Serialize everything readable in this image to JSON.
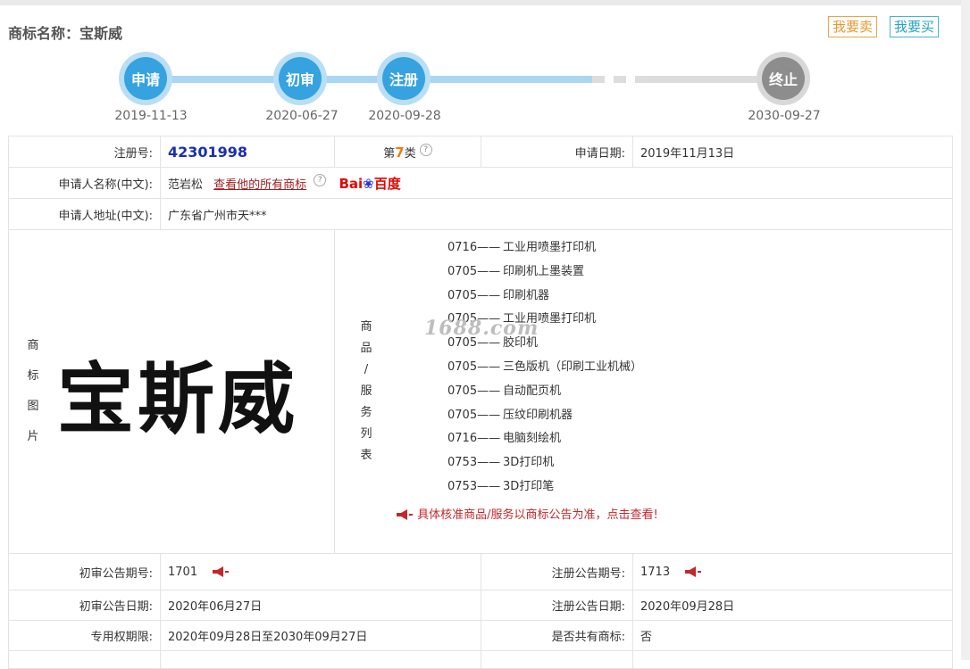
{
  "header": {
    "title": "商标名称：宝斯威",
    "sell_label": "我要卖",
    "buy_label": "我要买"
  },
  "timeline": {
    "nodes": [
      {
        "label": "申请",
        "date": "2019-11-13"
      },
      {
        "label": "初审",
        "date": "2020-06-27"
      },
      {
        "label": "注册",
        "date": "2020-09-28"
      },
      {
        "label": "终止",
        "date": "2030-09-27"
      }
    ]
  },
  "info": {
    "reg_no_label": "注册号:",
    "reg_no": "42301998",
    "class_prefix": "第",
    "class_num": "7",
    "class_suffix": "类",
    "apply_date_label": "申请日期:",
    "apply_date": "2019年11月13日",
    "applicant_label": "申请人名称(中文):",
    "applicant": "范岩松",
    "view_all_link": "查看他的所有商标",
    "baidu_bai": "Bai",
    "baidu_du": "百度",
    "address_label": "申请人地址(中文):",
    "address": "广东省广州市天***",
    "image_label_chars": [
      "商",
      "标",
      "图",
      "片"
    ],
    "trademark_text": "宝斯威",
    "goods_label_chars": [
      "商",
      "品",
      "/",
      "服",
      "务",
      "列",
      "表"
    ],
    "goods": [
      {
        "code": "0716——",
        "name": "工业用喷墨打印机"
      },
      {
        "code": "0705——",
        "name": "印刷机上墨装置"
      },
      {
        "code": "0705——",
        "name": "印刷机器"
      },
      {
        "code": "0705——",
        "name": "工业用喷墨打印机"
      },
      {
        "code": "0705——",
        "name": "胶印机"
      },
      {
        "code": "0705——",
        "name": "三色版机（印刷工业机械）"
      },
      {
        "code": "0705——",
        "name": "自动配页机"
      },
      {
        "code": "0705——",
        "name": "压纹印刷机器"
      },
      {
        "code": "0716——",
        "name": "电脑刻绘机"
      },
      {
        "code": "0753——",
        "name": "3D打印机"
      },
      {
        "code": "0753——",
        "name": "3D打印笔"
      }
    ],
    "goods_note": "具体核准商品/服务以商标公告为准，点击查看!",
    "watermark": "1688.com",
    "prelim_issue_label": "初审公告期号:",
    "prelim_issue": "1701",
    "reg_issue_label": "注册公告期号:",
    "reg_issue": "1713",
    "prelim_date_label": "初审公告日期:",
    "prelim_date": "2020年06月27日",
    "reg_date_label": "注册公告日期:",
    "reg_date": "2020年09月28日",
    "exclusive_label": "专用权期限:",
    "exclusive_period": "2020年09月28日至2030年09月27日",
    "shared_label": "是否共有商标:",
    "shared": "否"
  }
}
